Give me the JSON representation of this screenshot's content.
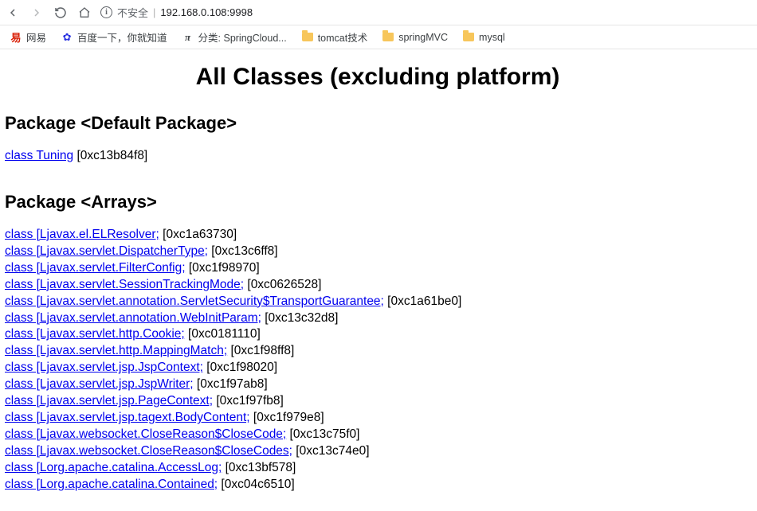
{
  "toolbar": {
    "insecure_label": "不安全",
    "addr_separator": "|",
    "url": "192.168.0.108:9998"
  },
  "bookmarks": [
    {
      "icon": "netease",
      "label": "网易"
    },
    {
      "icon": "baidu",
      "label": "百度一下，你就知道"
    },
    {
      "icon": "pi",
      "label": "分类: SpringCloud..."
    },
    {
      "icon": "folder",
      "label": "tomcat技术"
    },
    {
      "icon": "folder",
      "label": "springMVC"
    },
    {
      "icon": "folder",
      "label": "mysql"
    }
  ],
  "page": {
    "title": "All Classes (excluding platform)"
  },
  "packages": [
    {
      "heading": "Package <Default Package>",
      "entries": [
        {
          "link": "class Tuning",
          "suffix": " [0xc13b84f8]"
        }
      ]
    },
    {
      "heading": "Package <Arrays>",
      "entries": [
        {
          "link": "class [Ljavax.el.ELResolver;",
          "suffix": " [0xc1a63730]"
        },
        {
          "link": "class [Ljavax.servlet.DispatcherType;",
          "suffix": " [0xc13c6ff8]"
        },
        {
          "link": "class [Ljavax.servlet.FilterConfig;",
          "suffix": " [0xc1f98970]"
        },
        {
          "link": "class [Ljavax.servlet.SessionTrackingMode;",
          "suffix": " [0xc0626528]"
        },
        {
          "link": "class [Ljavax.servlet.annotation.ServletSecurity$TransportGuarantee;",
          "suffix": " [0xc1a61be0]"
        },
        {
          "link": "class [Ljavax.servlet.annotation.WebInitParam;",
          "suffix": " [0xc13c32d8]"
        },
        {
          "link": "class [Ljavax.servlet.http.Cookie;",
          "suffix": " [0xc0181110]"
        },
        {
          "link": "class [Ljavax.servlet.http.MappingMatch;",
          "suffix": " [0xc1f98ff8]"
        },
        {
          "link": "class [Ljavax.servlet.jsp.JspContext;",
          "suffix": " [0xc1f98020]"
        },
        {
          "link": "class [Ljavax.servlet.jsp.JspWriter;",
          "suffix": " [0xc1f97ab8]"
        },
        {
          "link": "class [Ljavax.servlet.jsp.PageContext;",
          "suffix": " [0xc1f97fb8]"
        },
        {
          "link": "class [Ljavax.servlet.jsp.tagext.BodyContent;",
          "suffix": " [0xc1f979e8]"
        },
        {
          "link": "class [Ljavax.websocket.CloseReason$CloseCode;",
          "suffix": " [0xc13c75f0]"
        },
        {
          "link": "class [Ljavax.websocket.CloseReason$CloseCodes;",
          "suffix": " [0xc13c74e0]"
        },
        {
          "link": "class [Lorg.apache.catalina.AccessLog;",
          "suffix": " [0xc13bf578]"
        },
        {
          "link": "class [Lorg.apache.catalina.Contained;",
          "suffix": " [0xc04c6510]"
        }
      ]
    }
  ]
}
